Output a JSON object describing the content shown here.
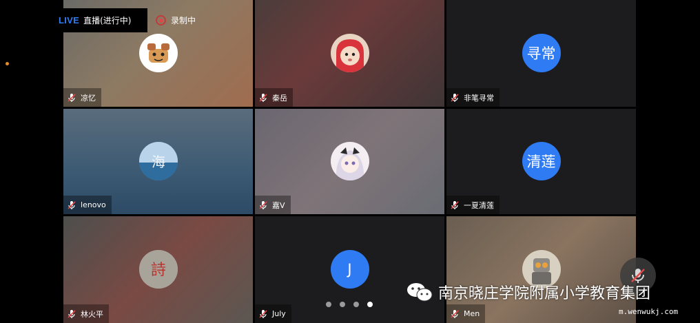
{
  "header": {
    "live_word": "LIVE",
    "live_status": "直播(进行中)",
    "recording_label": "录制中"
  },
  "participants": [
    {
      "name": "凉忆",
      "avatar": "cartoon-avatar"
    },
    {
      "name": "秦岳",
      "avatar": "child-photo-avatar"
    },
    {
      "name": "非笔寻常",
      "avatar_text": "寻常"
    },
    {
      "name": "lenovo",
      "avatar": "sea-calligraphy-avatar"
    },
    {
      "name": "嘉V",
      "avatar": "anime-girl-avatar"
    },
    {
      "name": "一夏清莲",
      "avatar_text": "清莲"
    },
    {
      "name": "林火平",
      "avatar": "calligraphy-avatar"
    },
    {
      "name": "July",
      "avatar_text": "J"
    },
    {
      "name": "Men",
      "avatar": "robot-toy-avatar"
    }
  ],
  "pager": {
    "count": 4,
    "active_index": 3
  },
  "watermark": {
    "text": "南京晓庄学院附属小学教育集团",
    "site": "m.wenwukj.com"
  },
  "colors": {
    "accent": "#2f7bf4",
    "recording": "#e04848"
  }
}
